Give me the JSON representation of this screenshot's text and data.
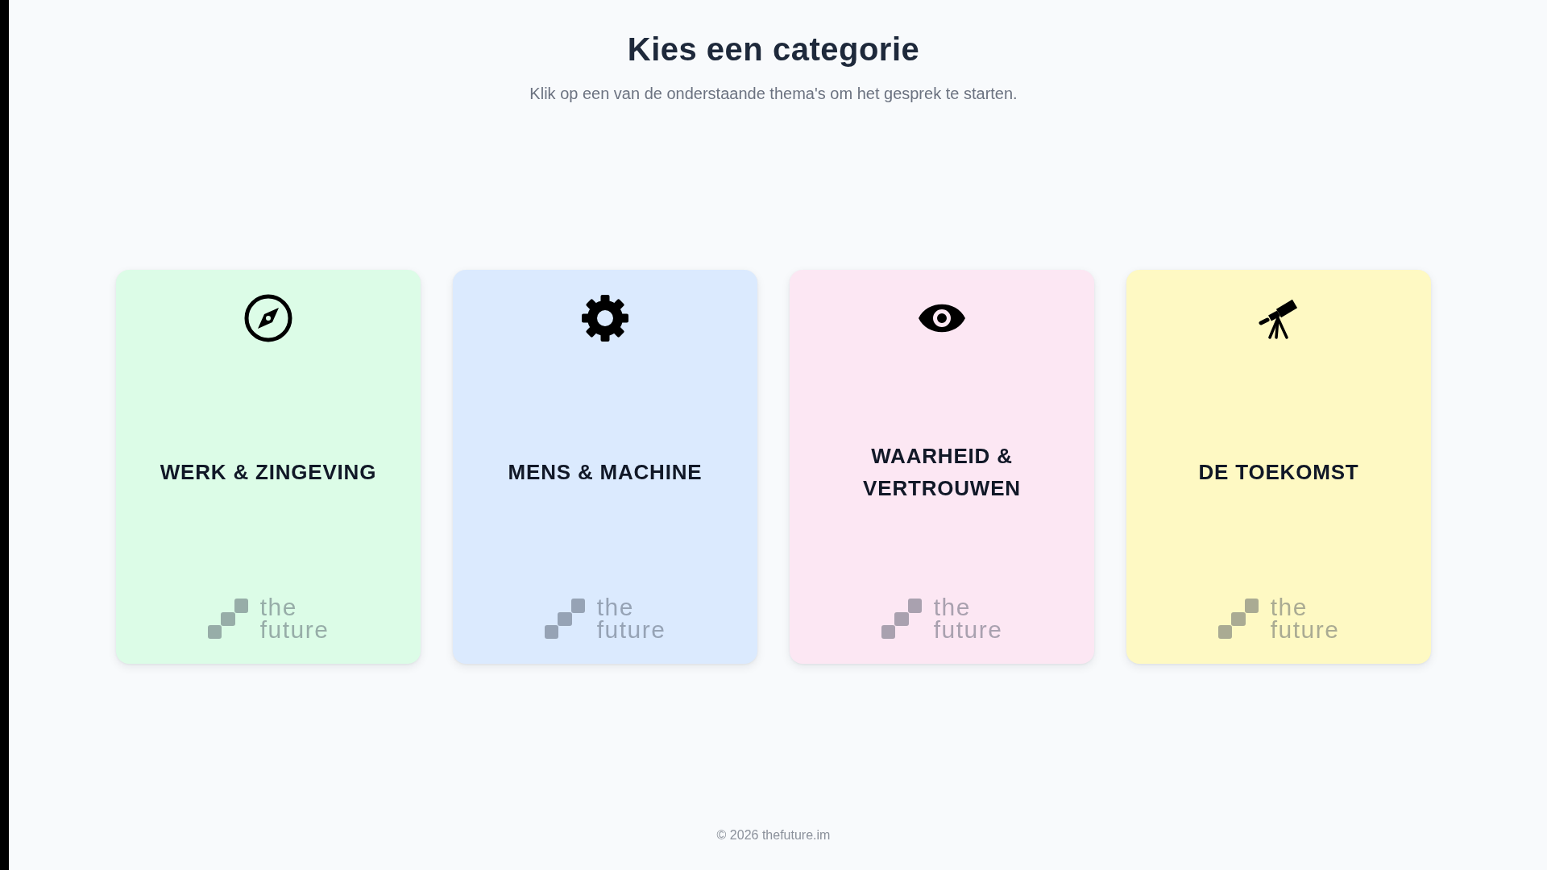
{
  "header": {
    "title": "Kies een categorie",
    "subtitle": "Klik op een van de onderstaande thema's om het gesprek te starten."
  },
  "categories": [
    {
      "kind": "compass",
      "title": "WERK & ZINGEVING",
      "color": "#dcfce7",
      "logo_text": "the future"
    },
    {
      "kind": "gear",
      "title": "MENS & MACHINE",
      "color": "#dbeafe",
      "logo_text": "the future"
    },
    {
      "kind": "eye",
      "title": "WAARHEID & VERTROUWEN",
      "color": "#fce7f3",
      "logo_text": "the future"
    },
    {
      "kind": "telescope",
      "title": "DE TOEKOMST",
      "color": "#fef9c3",
      "logo_text": "the future"
    }
  ],
  "footer": {
    "copyright": "© 2026 thefuture.im"
  }
}
